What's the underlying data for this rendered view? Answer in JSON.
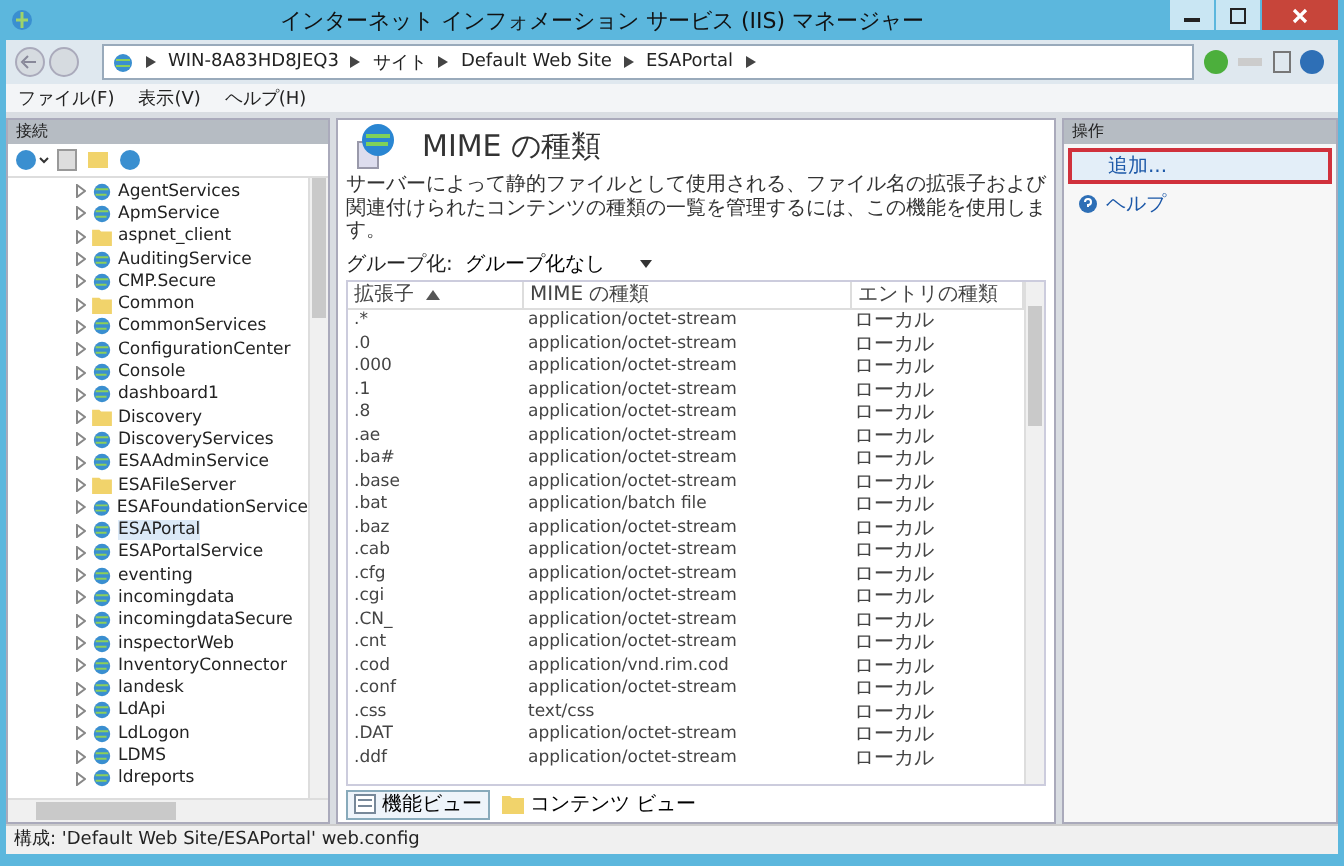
{
  "window": {
    "title": "インターネット インフォメーション サービス (IIS) マネージャー"
  },
  "breadcrumb": [
    "WIN-8A83HD8JEQ3",
    "サイト",
    "Default Web Site",
    "ESAPortal"
  ],
  "menu": [
    "ファイル(F)",
    "表示(V)",
    "ヘルプ(H)"
  ],
  "connections": {
    "title": "接続",
    "items": [
      {
        "label": "AgentServices",
        "kind": "app",
        "selected": false
      },
      {
        "label": "ApmService",
        "kind": "app",
        "selected": false
      },
      {
        "label": "aspnet_client",
        "kind": "folder",
        "selected": false
      },
      {
        "label": "AuditingService",
        "kind": "app",
        "selected": false
      },
      {
        "label": "CMP.Secure",
        "kind": "app",
        "selected": false
      },
      {
        "label": "Common",
        "kind": "folder",
        "selected": false
      },
      {
        "label": "CommonServices",
        "kind": "app",
        "selected": false
      },
      {
        "label": "ConfigurationCenter",
        "kind": "app",
        "selected": false
      },
      {
        "label": "Console",
        "kind": "app",
        "selected": false
      },
      {
        "label": "dashboard1",
        "kind": "app",
        "selected": false
      },
      {
        "label": "Discovery",
        "kind": "folder",
        "selected": false
      },
      {
        "label": "DiscoveryServices",
        "kind": "app",
        "selected": false
      },
      {
        "label": "ESAAdminService",
        "kind": "app",
        "selected": false
      },
      {
        "label": "ESAFileServer",
        "kind": "folder",
        "selected": false
      },
      {
        "label": "ESAFoundationService",
        "kind": "app",
        "selected": false
      },
      {
        "label": "ESAPortal",
        "kind": "app",
        "selected": true
      },
      {
        "label": "ESAPortalService",
        "kind": "app",
        "selected": false
      },
      {
        "label": "eventing",
        "kind": "app",
        "selected": false
      },
      {
        "label": "incomingdata",
        "kind": "app",
        "selected": false
      },
      {
        "label": "incomingdataSecure",
        "kind": "app",
        "selected": false
      },
      {
        "label": "inspectorWeb",
        "kind": "app",
        "selected": false
      },
      {
        "label": "InventoryConnector",
        "kind": "app",
        "selected": false
      },
      {
        "label": "landesk",
        "kind": "app",
        "selected": false
      },
      {
        "label": "LdApi",
        "kind": "app",
        "selected": false
      },
      {
        "label": "LdLogon",
        "kind": "app",
        "selected": false
      },
      {
        "label": "LDMS",
        "kind": "app",
        "selected": false
      },
      {
        "label": "ldreports",
        "kind": "app",
        "selected": false
      }
    ]
  },
  "feature": {
    "title": "MIME の種類",
    "description": "サーバーによって静的ファイルとして使用される、ファイル名の拡張子および関連付けられたコンテンツの種類の一覧を管理するには、この機能を使用します。",
    "group_label": "グループ化:",
    "group_value": "グループ化なし",
    "columns": [
      "拡張子",
      "MIME の種類",
      "エントリの種類"
    ],
    "rows": [
      [
        ".*",
        "application/octet-stream",
        "ローカル"
      ],
      [
        ".0",
        "application/octet-stream",
        "ローカル"
      ],
      [
        ".000",
        "application/octet-stream",
        "ローカル"
      ],
      [
        ".1",
        "application/octet-stream",
        "ローカル"
      ],
      [
        ".8",
        "application/octet-stream",
        "ローカル"
      ],
      [
        ".ae",
        "application/octet-stream",
        "ローカル"
      ],
      [
        ".ba#",
        "application/octet-stream",
        "ローカル"
      ],
      [
        ".base",
        "application/octet-stream",
        "ローカル"
      ],
      [
        ".bat",
        "application/batch file",
        "ローカル"
      ],
      [
        ".baz",
        "application/octet-stream",
        "ローカル"
      ],
      [
        ".cab",
        "application/octet-stream",
        "ローカル"
      ],
      [
        ".cfg",
        "application/octet-stream",
        "ローカル"
      ],
      [
        ".cgi",
        "application/octet-stream",
        "ローカル"
      ],
      [
        ".CN_",
        "application/octet-stream",
        "ローカル"
      ],
      [
        ".cnt",
        "application/octet-stream",
        "ローカル"
      ],
      [
        ".cod",
        "application/vnd.rim.cod",
        "ローカル"
      ],
      [
        ".conf",
        "application/octet-stream",
        "ローカル"
      ],
      [
        ".css",
        "text/css",
        "ローカル"
      ],
      [
        ".DAT",
        "application/octet-stream",
        "ローカル"
      ],
      [
        ".ddf",
        "application/octet-stream",
        "ローカル"
      ]
    ]
  },
  "view_tabs": [
    {
      "label": "機能ビュー",
      "selected": true
    },
    {
      "label": "コンテンツ ビュー",
      "selected": false
    }
  ],
  "actions": {
    "title": "操作",
    "items": [
      {
        "label": "追加...",
        "kind": "link",
        "selected": true
      },
      {
        "label": "ヘルプ",
        "kind": "help",
        "selected": false
      }
    ]
  },
  "status_bar": "構成: 'Default Web Site/ESAPortal' web.config"
}
